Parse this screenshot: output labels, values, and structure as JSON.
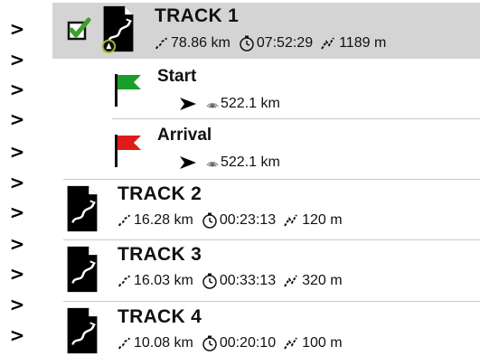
{
  "gutter": {
    "chevrons": [
      ">",
      ">",
      ">",
      ">",
      ">",
      ">",
      ">",
      ">",
      ">",
      ">",
      ">"
    ]
  },
  "tracks": [
    {
      "name": "TRACK 1",
      "selected": true,
      "checked": true,
      "distance": "78.86 km",
      "duration": "07:52:29",
      "elevation": "1189 m",
      "waypoints": [
        {
          "name": "Start",
          "flag_color": "#1a9e2a",
          "distance": "522.1 km"
        },
        {
          "name": "Arrival",
          "flag_color": "#e01b1b",
          "distance": "522.1 km"
        }
      ]
    },
    {
      "name": "TRACK 2",
      "distance": "16.28 km",
      "duration": "00:23:13",
      "elevation": "120 m"
    },
    {
      "name": "TRACK 3",
      "distance": "16.03 km",
      "duration": "00:33:13",
      "elevation": "320 m"
    },
    {
      "name": "TRACK 4",
      "distance": "10.08 km",
      "duration": "00:20:10",
      "elevation": "100 m"
    }
  ],
  "colors": {
    "selected_row": "#d4d4d4",
    "checkbox_check": "#3aa12a",
    "separator": "#c9c9c9"
  },
  "icons": {
    "track": "track-route-icon",
    "distance": "distance-route-icon",
    "duration": "stopwatch-icon",
    "elevation": "elevation-icon",
    "direction": "direction-arrow-icon",
    "gps": "gps-signal-icon"
  }
}
